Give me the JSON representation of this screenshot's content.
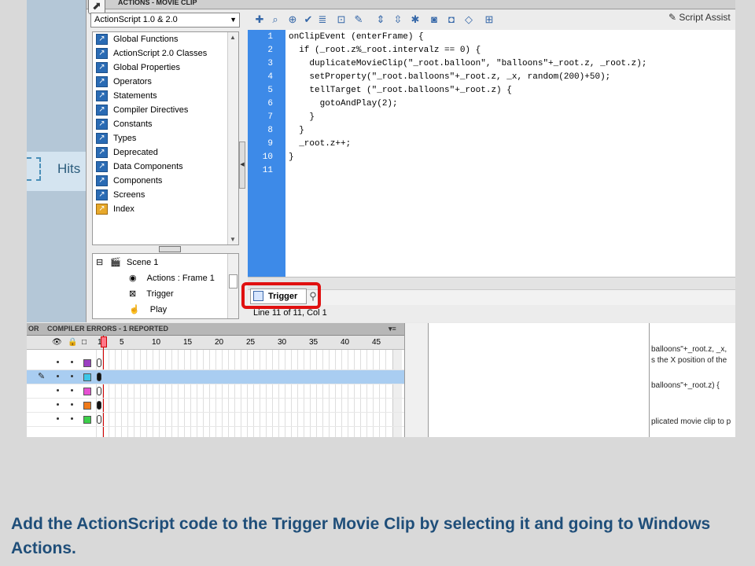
{
  "window": {
    "panel_title": "ACTIONS - MOVIE CLIP",
    "language_select": "ActionScript 1.0 & 2.0",
    "script_assist": "Script Assist"
  },
  "toolbar_icons": [
    "add-icon",
    "find-icon",
    "target-icon",
    "check-syntax-icon",
    "auto-format-icon",
    "code-hint-icon",
    "debug-icon",
    "collapse-icon",
    "collapse-selection-icon",
    "expand-all-icon",
    "apply-block-comment-icon",
    "apply-line-comment-icon",
    "remove-comment-icon",
    "show-hide-toolbox-icon"
  ],
  "action_tree": [
    "Global Functions",
    "ActionScript 2.0 Classes",
    "Global Properties",
    "Operators",
    "Statements",
    "Compiler Directives",
    "Constants",
    "Types",
    "Deprecated",
    "Data Components",
    "Components",
    "Screens",
    "Index"
  ],
  "script_nav": {
    "scene": "Scene 1",
    "items": [
      "Actions : Frame 1",
      "Trigger",
      "Play"
    ]
  },
  "editor": {
    "lines": [
      "onClipEvent (enterFrame) {",
      "  if (_root.z%_root.intervalz == 0) {",
      "    duplicateMovieClip(\"_root.balloon\", \"balloons\"+_root.z, _root.z);",
      "    setProperty(\"_root.balloons\"+_root.z, _x, random(200)+50);",
      "    tellTarget (\"_root.balloons\"+_root.z) {",
      "      gotoAndPlay(2);",
      "    }",
      "  }",
      "  _root.z++;",
      "}",
      ""
    ],
    "tab_label": "Trigger",
    "status": "Line 11 of 11, Col 1"
  },
  "stage": {
    "label": "Hits"
  },
  "bottom_tabs": [
    "OR",
    "COMPILER ERRORS - 1 REPORTED"
  ],
  "timeline": {
    "frame_numbers": [
      "1",
      "5",
      "10",
      "15",
      "20",
      "25",
      "30",
      "35",
      "40",
      "45"
    ],
    "layer_colors": [
      "#9b3fc2",
      "#3cc6e8",
      "#e650d2",
      "#f07a1a",
      "#3ccf4a"
    ],
    "selected_layer": 1
  },
  "right_panel": {
    "snippets": [
      "balloons\"+_root.z, _x,",
      "s the X position of the",
      "balloons\"+_root.z) {",
      "plicated movie clip to p"
    ]
  },
  "caption": "Add the ActionScript code to the Trigger Movie Clip by selecting it and going to Windows Actions.",
  "colors": {
    "gutter": "#3d8ae8",
    "highlight": "#e01010",
    "caption": "#1f4e79"
  }
}
